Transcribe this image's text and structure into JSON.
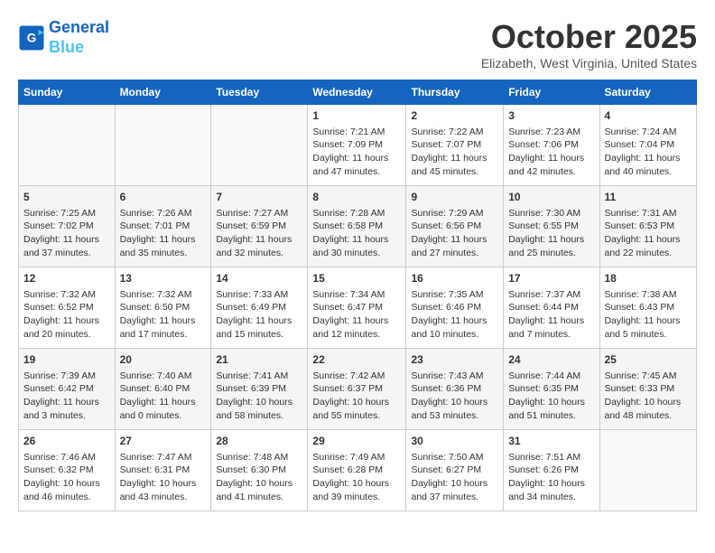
{
  "header": {
    "logo_line1": "General",
    "logo_line2": "Blue",
    "month": "October 2025",
    "location": "Elizabeth, West Virginia, United States"
  },
  "days_of_week": [
    "Sunday",
    "Monday",
    "Tuesday",
    "Wednesday",
    "Thursday",
    "Friday",
    "Saturday"
  ],
  "weeks": [
    [
      {
        "day": "",
        "info": ""
      },
      {
        "day": "",
        "info": ""
      },
      {
        "day": "",
        "info": ""
      },
      {
        "day": "1",
        "info": "Sunrise: 7:21 AM\nSunset: 7:09 PM\nDaylight: 11 hours and 47 minutes."
      },
      {
        "day": "2",
        "info": "Sunrise: 7:22 AM\nSunset: 7:07 PM\nDaylight: 11 hours and 45 minutes."
      },
      {
        "day": "3",
        "info": "Sunrise: 7:23 AM\nSunset: 7:06 PM\nDaylight: 11 hours and 42 minutes."
      },
      {
        "day": "4",
        "info": "Sunrise: 7:24 AM\nSunset: 7:04 PM\nDaylight: 11 hours and 40 minutes."
      }
    ],
    [
      {
        "day": "5",
        "info": "Sunrise: 7:25 AM\nSunset: 7:02 PM\nDaylight: 11 hours and 37 minutes."
      },
      {
        "day": "6",
        "info": "Sunrise: 7:26 AM\nSunset: 7:01 PM\nDaylight: 11 hours and 35 minutes."
      },
      {
        "day": "7",
        "info": "Sunrise: 7:27 AM\nSunset: 6:59 PM\nDaylight: 11 hours and 32 minutes."
      },
      {
        "day": "8",
        "info": "Sunrise: 7:28 AM\nSunset: 6:58 PM\nDaylight: 11 hours and 30 minutes."
      },
      {
        "day": "9",
        "info": "Sunrise: 7:29 AM\nSunset: 6:56 PM\nDaylight: 11 hours and 27 minutes."
      },
      {
        "day": "10",
        "info": "Sunrise: 7:30 AM\nSunset: 6:55 PM\nDaylight: 11 hours and 25 minutes."
      },
      {
        "day": "11",
        "info": "Sunrise: 7:31 AM\nSunset: 6:53 PM\nDaylight: 11 hours and 22 minutes."
      }
    ],
    [
      {
        "day": "12",
        "info": "Sunrise: 7:32 AM\nSunset: 6:52 PM\nDaylight: 11 hours and 20 minutes."
      },
      {
        "day": "13",
        "info": "Sunrise: 7:32 AM\nSunset: 6:50 PM\nDaylight: 11 hours and 17 minutes."
      },
      {
        "day": "14",
        "info": "Sunrise: 7:33 AM\nSunset: 6:49 PM\nDaylight: 11 hours and 15 minutes."
      },
      {
        "day": "15",
        "info": "Sunrise: 7:34 AM\nSunset: 6:47 PM\nDaylight: 11 hours and 12 minutes."
      },
      {
        "day": "16",
        "info": "Sunrise: 7:35 AM\nSunset: 6:46 PM\nDaylight: 11 hours and 10 minutes."
      },
      {
        "day": "17",
        "info": "Sunrise: 7:37 AM\nSunset: 6:44 PM\nDaylight: 11 hours and 7 minutes."
      },
      {
        "day": "18",
        "info": "Sunrise: 7:38 AM\nSunset: 6:43 PM\nDaylight: 11 hours and 5 minutes."
      }
    ],
    [
      {
        "day": "19",
        "info": "Sunrise: 7:39 AM\nSunset: 6:42 PM\nDaylight: 11 hours and 3 minutes."
      },
      {
        "day": "20",
        "info": "Sunrise: 7:40 AM\nSunset: 6:40 PM\nDaylight: 11 hours and 0 minutes."
      },
      {
        "day": "21",
        "info": "Sunrise: 7:41 AM\nSunset: 6:39 PM\nDaylight: 10 hours and 58 minutes."
      },
      {
        "day": "22",
        "info": "Sunrise: 7:42 AM\nSunset: 6:37 PM\nDaylight: 10 hours and 55 minutes."
      },
      {
        "day": "23",
        "info": "Sunrise: 7:43 AM\nSunset: 6:36 PM\nDaylight: 10 hours and 53 minutes."
      },
      {
        "day": "24",
        "info": "Sunrise: 7:44 AM\nSunset: 6:35 PM\nDaylight: 10 hours and 51 minutes."
      },
      {
        "day": "25",
        "info": "Sunrise: 7:45 AM\nSunset: 6:33 PM\nDaylight: 10 hours and 48 minutes."
      }
    ],
    [
      {
        "day": "26",
        "info": "Sunrise: 7:46 AM\nSunset: 6:32 PM\nDaylight: 10 hours and 46 minutes."
      },
      {
        "day": "27",
        "info": "Sunrise: 7:47 AM\nSunset: 6:31 PM\nDaylight: 10 hours and 43 minutes."
      },
      {
        "day": "28",
        "info": "Sunrise: 7:48 AM\nSunset: 6:30 PM\nDaylight: 10 hours and 41 minutes."
      },
      {
        "day": "29",
        "info": "Sunrise: 7:49 AM\nSunset: 6:28 PM\nDaylight: 10 hours and 39 minutes."
      },
      {
        "day": "30",
        "info": "Sunrise: 7:50 AM\nSunset: 6:27 PM\nDaylight: 10 hours and 37 minutes."
      },
      {
        "day": "31",
        "info": "Sunrise: 7:51 AM\nSunset: 6:26 PM\nDaylight: 10 hours and 34 minutes."
      },
      {
        "day": "",
        "info": ""
      }
    ]
  ]
}
